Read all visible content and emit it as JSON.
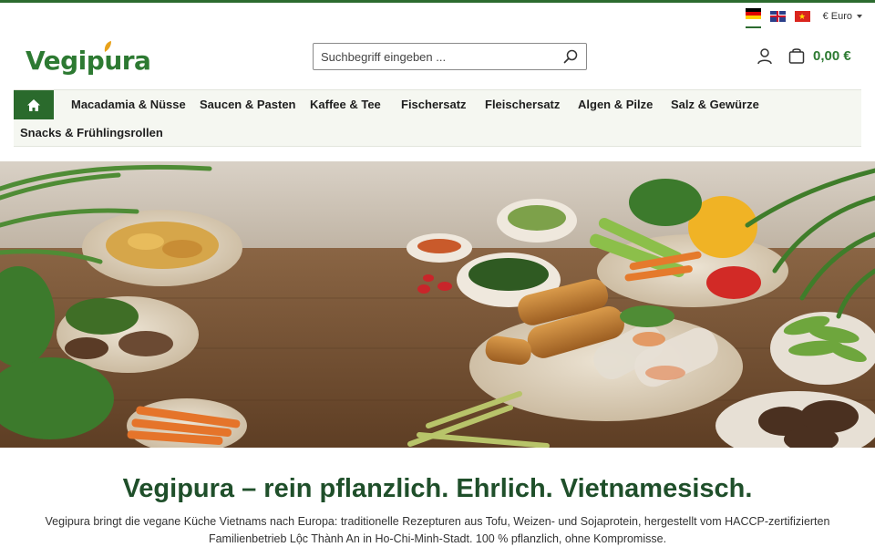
{
  "brand": {
    "name": "Vegipura",
    "primary_color": "#2d7a32",
    "dark_color": "#1f4f2a"
  },
  "topbar": {
    "languages": [
      {
        "code": "de",
        "icon": "german-flag-icon",
        "active": true
      },
      {
        "code": "en",
        "icon": "uk-flag-icon",
        "active": false
      },
      {
        "code": "vi",
        "icon": "vietnam-flag-icon",
        "active": false
      }
    ],
    "currency_label": "€ Euro"
  },
  "search": {
    "placeholder": "Suchbegriff eingeben ..."
  },
  "cart": {
    "total": "0,00 €"
  },
  "nav": {
    "items": [
      {
        "label": "Macadamia & Nüsse"
      },
      {
        "label": "Saucen & Pasten"
      },
      {
        "label": "Kaffee & Tee"
      },
      {
        "label": "Fischersatz"
      },
      {
        "label": "Fleischersatz"
      },
      {
        "label": "Algen & Pilze"
      },
      {
        "label": "Salz & Gewürze"
      },
      {
        "label": "Snacks & Frühlingsrollen"
      }
    ]
  },
  "intro": {
    "headline": "Vegipura – rein pflanzlich. Ehrlich. Vietnamesisch.",
    "text": "Vegipura bringt die vegane Küche Vietnams nach Europa: traditionelle Rezepturen aus Tofu, Weizen- und Sojaprotein, hergestellt vom HACCP-zertifizierten Familienbetrieb Lộc Thành An in Ho-Chi-Minh-Stadt. 100 % pflanzlich, ohne Kompromisse."
  }
}
